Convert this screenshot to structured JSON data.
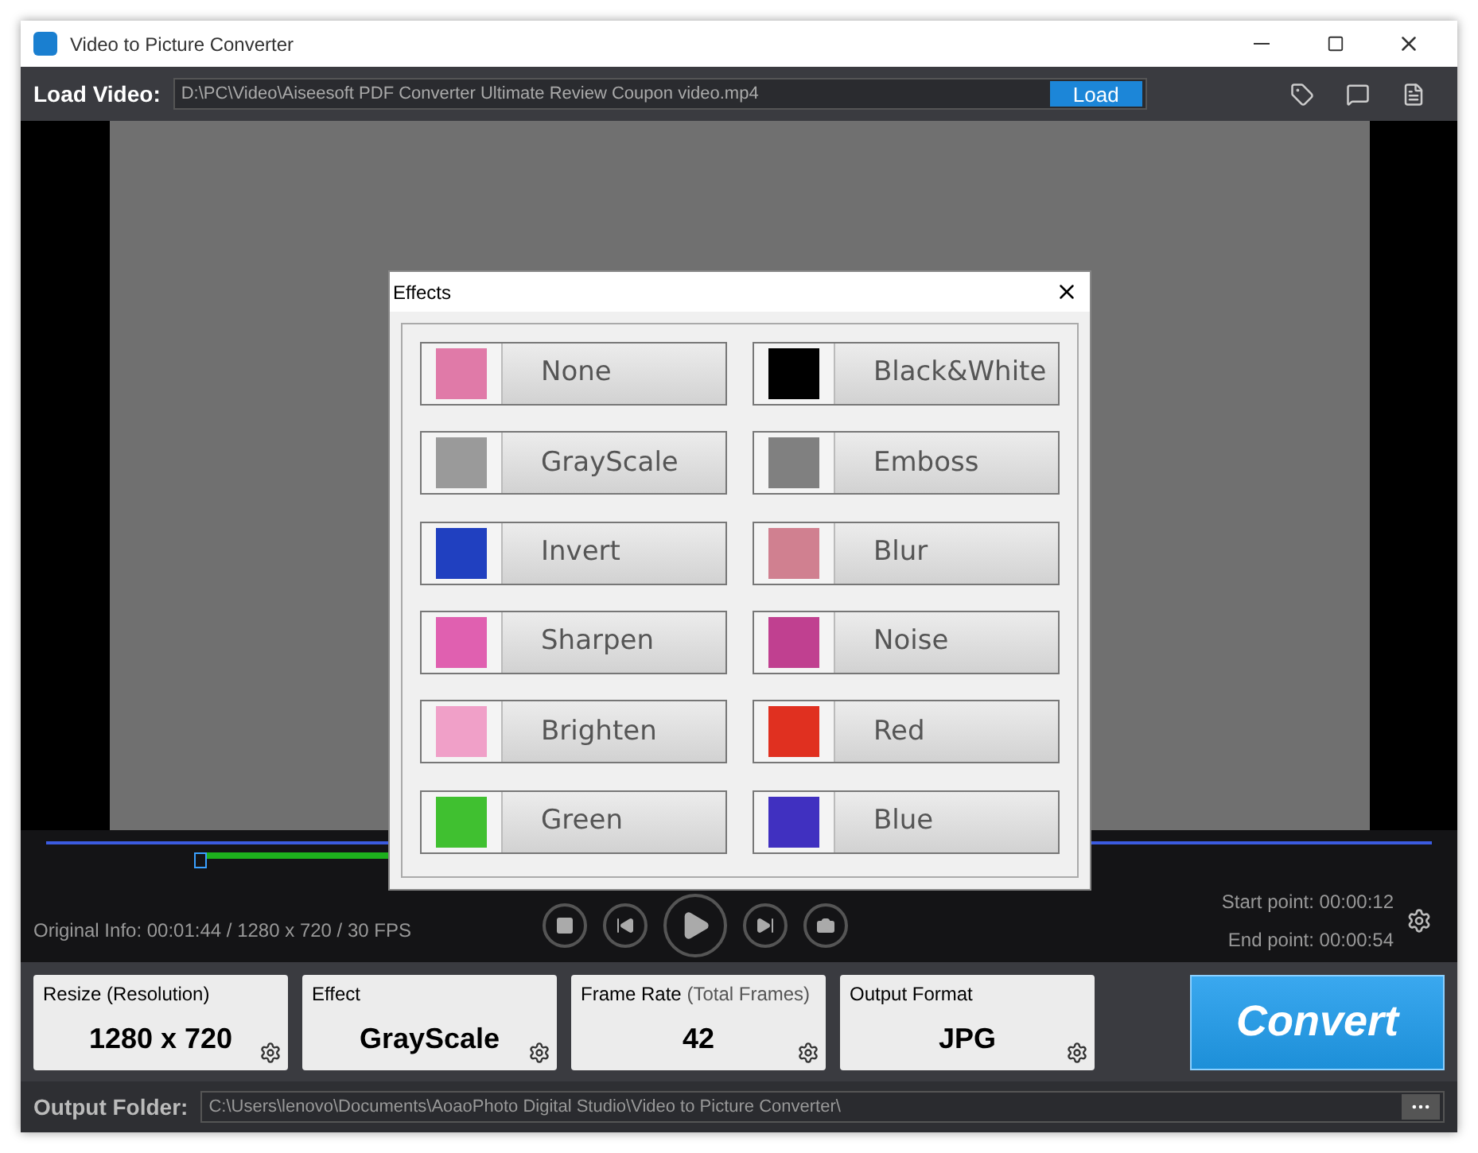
{
  "window": {
    "title": "Video to Picture Converter"
  },
  "load_video": {
    "label": "Load Video:",
    "path": "D:\\PC\\Video\\Aiseesoft PDF Converter Ultimate Review Coupon video.mp4",
    "button": "Load"
  },
  "playback": {
    "original_info": "Original Info: 00:01:44 / 1280 x 720 / 30 FPS",
    "start_point": "Start point: 00:00:12",
    "end_point": "End point: 00:00:54"
  },
  "settings": [
    {
      "label": "Resize (Resolution)",
      "value": "1280 x 720"
    },
    {
      "label": "Effect",
      "value": "GrayScale"
    },
    {
      "label": "Frame Rate",
      "note": "(Total Frames)",
      "value": "42"
    },
    {
      "label": "Output Format",
      "value": "JPG"
    }
  ],
  "convert_button": "Convert",
  "output_folder": {
    "label": "Output Folder:",
    "path": "C:\\Users\\lenovo\\Documents\\AoaoPhoto Digital Studio\\Video to Picture Converter\\"
  },
  "effects_dialog": {
    "title": "Effects",
    "effects": [
      {
        "label": "None",
        "color": "#e07aa8"
      },
      {
        "label": "Black&White",
        "color": "#000000"
      },
      {
        "label": "GrayScale",
        "color": "#9a9a9a"
      },
      {
        "label": "Emboss",
        "color": "#808080"
      },
      {
        "label": "Invert",
        "color": "#2040c0"
      },
      {
        "label": "Blur",
        "color": "#d08090"
      },
      {
        "label": "Sharpen",
        "color": "#e060b0"
      },
      {
        "label": "Noise",
        "color": "#c04090"
      },
      {
        "label": "Brighten",
        "color": "#f0a0c8"
      },
      {
        "label": "Red",
        "color": "#e03020"
      },
      {
        "label": "Green",
        "color": "#40c030"
      },
      {
        "label": "Blue",
        "color": "#4030c0"
      }
    ]
  }
}
